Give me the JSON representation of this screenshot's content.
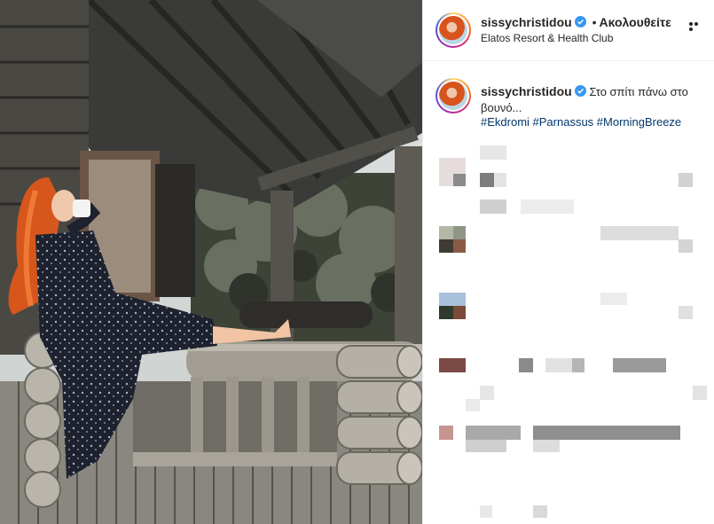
{
  "post": {
    "username": "sissychristidou",
    "follow_status": "Ακολουθείτε",
    "separator": "•",
    "location": "Elatos Resort & Health Club",
    "caption": "Στο σπίτι πάνω στο βουνό...",
    "hashtags": "#Ekdromi #Parnassus #MorningBreeze"
  },
  "icons": {
    "verified": "verified-badge-icon",
    "more": "more-options-icon"
  },
  "colors": {
    "verified": "#3897f0",
    "hashtag": "#00376b",
    "divider": "#efefef"
  }
}
